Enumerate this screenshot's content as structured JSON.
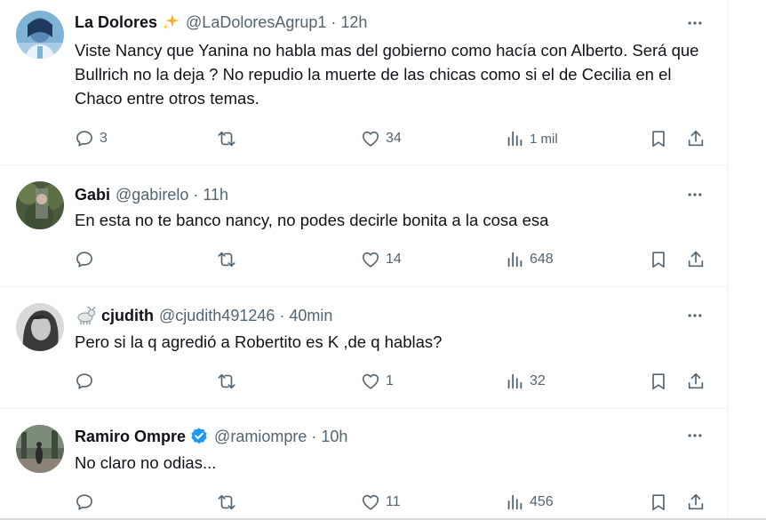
{
  "tweets": [
    {
      "name": "La Dolores",
      "emoji": "sparkles-icon",
      "handle": "@LaDoloresAgrup1",
      "time": "12h",
      "text": "Viste Nancy que Yanina no habla mas del gobierno como hacía con Alberto. Será que Bullrich no la deja ? No repudio la muerte de las chicas como si el de Cecilia en el Chaco entre otros temas.",
      "replies": "3",
      "retweets": "",
      "likes": "34",
      "views": "1 mil"
    },
    {
      "name": "Gabi",
      "handle": "@gabirelo",
      "time": "11h",
      "text": "En esta no te banco nancy, no podes decirle bonita a la cosa esa",
      "replies": "",
      "retweets": "",
      "likes": "14",
      "views": "648"
    },
    {
      "name": "cjudith",
      "emoji": "goat-icon",
      "handle": "@cjudith491246",
      "time": "40min",
      "text": "Pero si la q agredió a Robertito es K ,de q hablas?",
      "replies": "",
      "retweets": "",
      "likes": "1",
      "views": "32"
    },
    {
      "name": "Ramiro Ompre",
      "verified": true,
      "handle": "@ramiompre",
      "time": "10h",
      "text": "No claro no odias...",
      "replies": "",
      "retweets": "",
      "likes": "11",
      "views": "456"
    }
  ],
  "separator": "·",
  "colors": {
    "text": "#0f1419",
    "secondary": "#536471",
    "verified": "#1d9bf0",
    "sparkle": "#ffac33"
  }
}
